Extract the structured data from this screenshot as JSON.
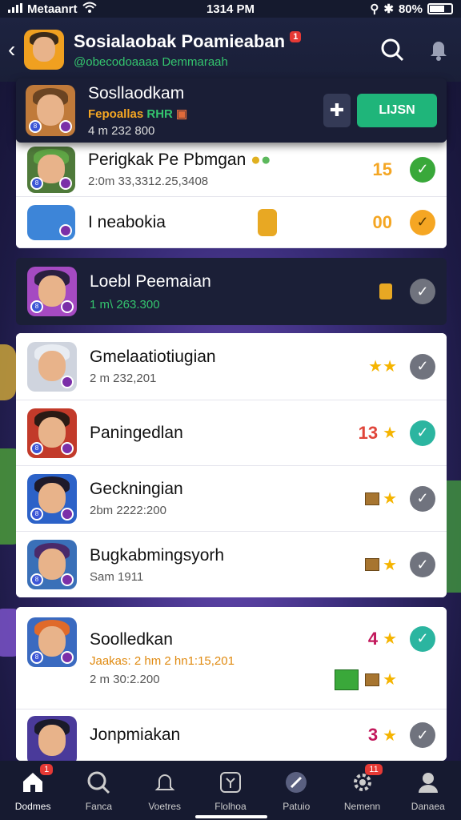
{
  "status": {
    "carrier": "Metaanrt",
    "time": "1314 PM",
    "battery": "80%"
  },
  "header": {
    "title": "Sosialaobak Poamieaban",
    "subtitle": "@obecodoaaaa Demmaraah",
    "notif": "1"
  },
  "featured": {
    "name": "Sosllaodkam",
    "tag": "Fepoallas",
    "tag_green": "RHR",
    "sub": "4 m 232 800",
    "join_label": "LIJSN"
  },
  "rows_top": [
    {
      "name": "Perigkak Pe Pbmgan",
      "sub": "2:0m 33,3312.25,3408",
      "num": "15",
      "num_color": "#f4a623"
    },
    {
      "name": "I neabokia",
      "sub": "",
      "num": "00",
      "num_color": "#f4a623"
    }
  ],
  "dark_row": {
    "name": "Loebl Peemaian",
    "sub": "1 m\\ 263.300"
  },
  "rows_group1": [
    {
      "name": "Gmelaatiotiugian",
      "sub": "2 m 232,201"
    },
    {
      "name": "Paningedlan",
      "sub": "",
      "num": "13",
      "num_color": "#e0453a"
    },
    {
      "name": "Geckningian",
      "sub": "2bm 2222:200"
    },
    {
      "name": "Bugkabmingsyorh",
      "sub": "Sam 1911"
    }
  ],
  "rows_group2": [
    {
      "name": "Soolledkan",
      "sub_orange": "Jaakas: 2 hm 2 hn1:15,201",
      "sub": "2 m 30:2.200",
      "num": "4",
      "num_color": "#c2185b"
    },
    {
      "name": "Jonpmiakan",
      "sub": "",
      "num": "3",
      "num_color": "#c2185b"
    }
  ],
  "tabs": [
    {
      "label": "Dodmes",
      "badge": "1",
      "icon": "home-icon"
    },
    {
      "label": "Fanca",
      "badge": "",
      "icon": "search-icon"
    },
    {
      "label": "Voetres",
      "badge": "",
      "icon": "bell-icon"
    },
    {
      "label": "Flolhoa",
      "badge": "",
      "icon": "game-icon"
    },
    {
      "label": "Patuio",
      "badge": "",
      "icon": "wrench-icon"
    },
    {
      "label": "Nemenn",
      "badge": "11",
      "icon": "gear-icon"
    },
    {
      "label": "Danaea",
      "badge": "",
      "icon": "profile-icon"
    }
  ],
  "colors": {
    "accent_green": "#1fb57a",
    "header_bg": "#1d2340",
    "check_teal": "#2bb5a0"
  }
}
